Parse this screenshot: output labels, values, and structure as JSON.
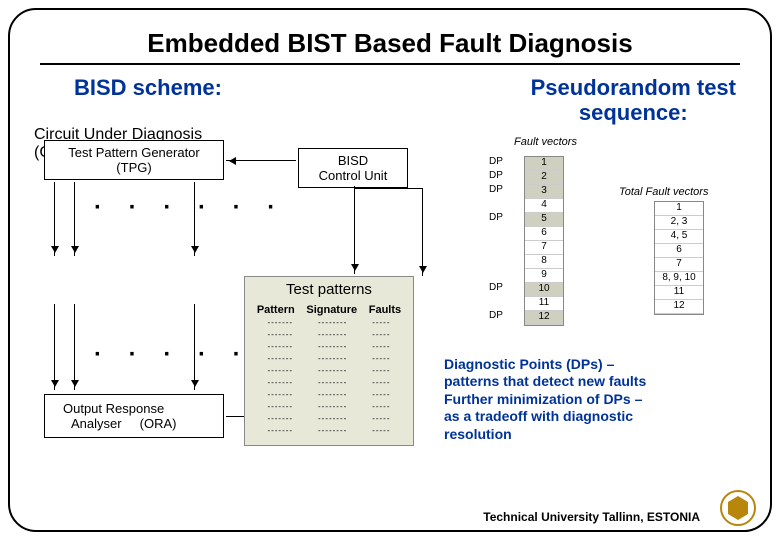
{
  "title": "Embedded BIST Based Fault Diagnosis",
  "left_heading": "BISD scheme:",
  "right_heading_l1": "Pseudorandom test",
  "right_heading_l2": "sequence:",
  "boxes": {
    "tpg_l1": "Test Pattern Generator",
    "tpg_l2": "(TPG)",
    "bisd_l1": "BISD",
    "bisd_l2": "Control Unit",
    "cud_l1": "Circuit Under Diagnosis",
    "cud_l2": "(CUD)",
    "ora_l1": "Output Response",
    "ora_l2": "Analyser     (ORA)"
  },
  "tp": {
    "title": "Test patterns",
    "h1": "Pattern",
    "h2": "Signature",
    "h3": "Faults"
  },
  "fv": {
    "title": "Fault vectors",
    "rtitle": "Total Fault vectors",
    "dp": "DP",
    "values": [
      "1",
      "2",
      "3",
      "4",
      "5",
      "6",
      "7",
      "8",
      "9",
      "10",
      "11",
      "12"
    ],
    "rvalues": [
      "1",
      "2, 3",
      "4, 5",
      "6",
      "7",
      "8, 9, 10",
      "11",
      "12"
    ]
  },
  "desc_l1": "Diagnostic Points (DPs) –",
  "desc_l2": "patterns that detect new faults",
  "desc_l3": "Further minimization of DPs –",
  "desc_l4": "as a tradeoff with diagnostic",
  "desc_l5": "resolution",
  "footer": "Technical University Tallinn, ESTONIA"
}
